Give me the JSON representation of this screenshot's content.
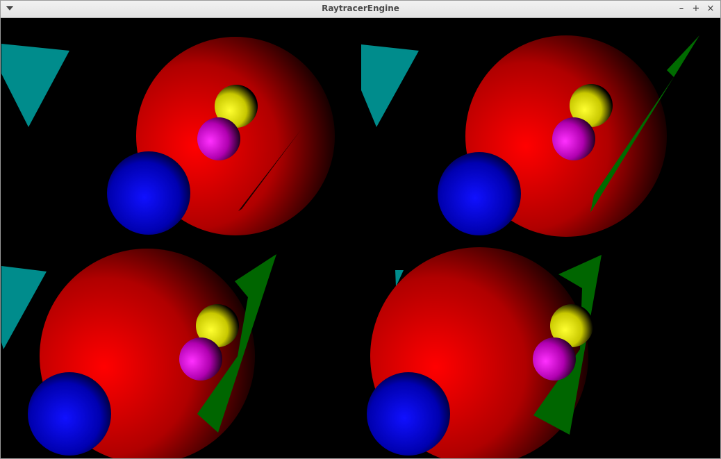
{
  "window": {
    "title": "RaytracerEngine",
    "controls": {
      "minimize": "–",
      "maximize": "+",
      "close": "×"
    }
  },
  "scene": {
    "background_color": "#000000",
    "render_panes": 4,
    "objects": [
      {
        "name": "large-sphere",
        "color": "#ff0000"
      },
      {
        "name": "blue-sphere",
        "color": "#0000ff"
      },
      {
        "name": "yellow-sphere",
        "color": "#ffff00"
      },
      {
        "name": "magenta-sphere",
        "color": "#ff00ff"
      },
      {
        "name": "cyan-triangle",
        "color": "#00a0a0"
      },
      {
        "name": "green-triangle",
        "color": "#008000"
      }
    ]
  }
}
